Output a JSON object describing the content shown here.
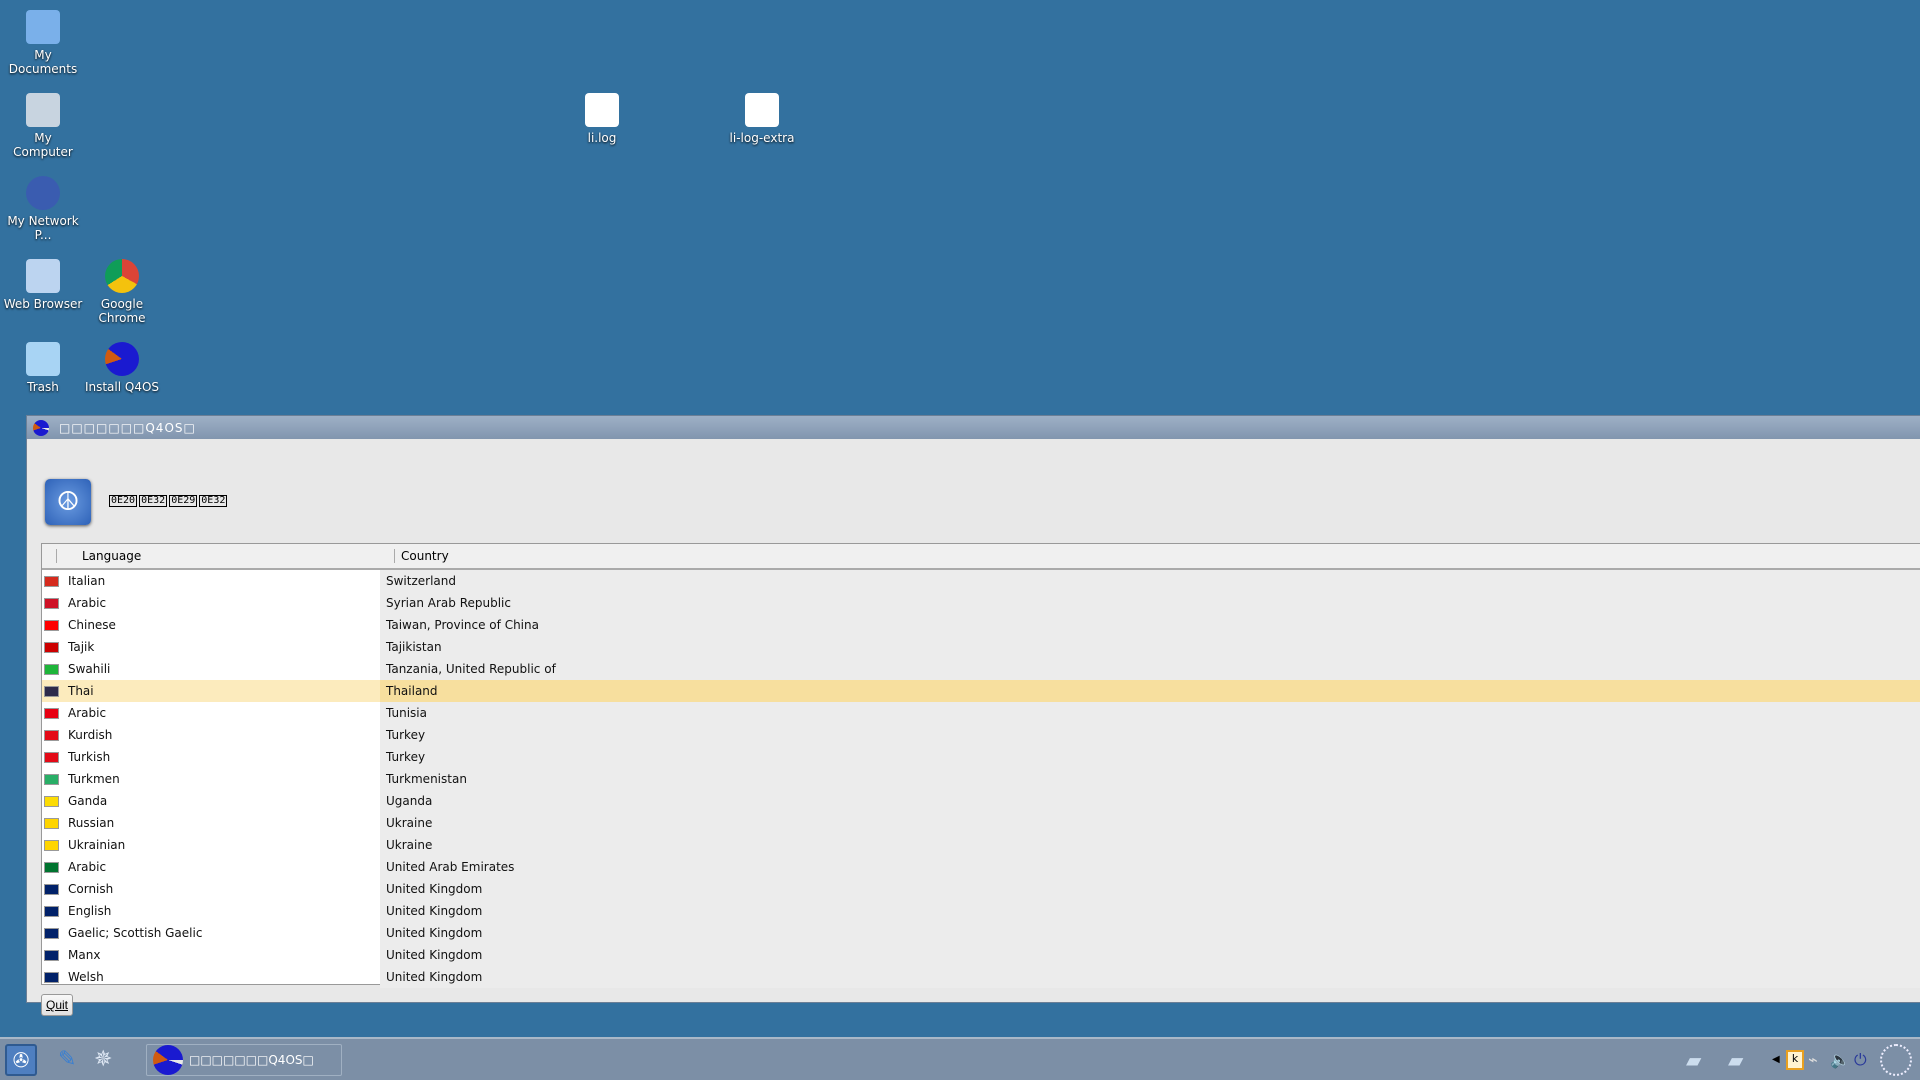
{
  "desktop": {
    "icons": [
      {
        "label": "My Documents",
        "icon": "folder-icon"
      },
      {
        "label": "My Computer",
        "icon": "computer-icon"
      },
      {
        "label": "My Network P...",
        "icon": "network-icon"
      },
      {
        "label": "Web Browser",
        "icon": "web-browser-icon"
      },
      {
        "label": "Google Chrome",
        "icon": "chrome-icon"
      },
      {
        "label": "Trash",
        "icon": "trash-icon"
      },
      {
        "label": "Install Q4OS",
        "icon": "q4os-icon"
      },
      {
        "label": "li.log",
        "icon": "chart-document-icon"
      },
      {
        "label": "li-log-extra",
        "icon": "text-document-icon"
      }
    ]
  },
  "window": {
    "title": "□□□□□□□Q4OS□",
    "header_text": [
      "0E20",
      "0E32",
      "0E29",
      "0E32"
    ],
    "columns": [
      "Language",
      "Country"
    ],
    "rows": [
      {
        "language": "Italian",
        "country": "Switzerland",
        "flag": "#d52b1e"
      },
      {
        "language": "Arabic",
        "country": "Syrian Arab Republic",
        "flag": "#ce1126"
      },
      {
        "language": "Chinese",
        "country": "Taiwan, Province of China",
        "flag": "#fe0000"
      },
      {
        "language": "Tajik",
        "country": "Tajikistan",
        "flag": "#cc0000"
      },
      {
        "language": "Swahili",
        "country": "Tanzania, United Republic of",
        "flag": "#1eb53a"
      },
      {
        "language": "Thai",
        "country": "Thailand",
        "flag": "#2d2a4a",
        "selected": true
      },
      {
        "language": "Arabic",
        "country": "Tunisia",
        "flag": "#e70013"
      },
      {
        "language": "Kurdish",
        "country": "Turkey",
        "flag": "#e30a17"
      },
      {
        "language": "Turkish",
        "country": "Turkey",
        "flag": "#e30a17"
      },
      {
        "language": "Turkmen",
        "country": "Turkmenistan",
        "flag": "#28ae66"
      },
      {
        "language": "Ganda",
        "country": "Uganda",
        "flag": "#fcdc04"
      },
      {
        "language": "Russian",
        "country": "Ukraine",
        "flag": "#ffd500"
      },
      {
        "language": "Ukrainian",
        "country": "Ukraine",
        "flag": "#ffd500"
      },
      {
        "language": "Arabic",
        "country": "United Arab Emirates",
        "flag": "#00732f"
      },
      {
        "language": "Cornish",
        "country": "United Kingdom",
        "flag": "#012169"
      },
      {
        "language": "English",
        "country": "United Kingdom",
        "flag": "#012169"
      },
      {
        "language": "Gaelic; Scottish Gaelic",
        "country": "United Kingdom",
        "flag": "#012169"
      },
      {
        "language": "Manx",
        "country": "United Kingdom",
        "flag": "#012169"
      },
      {
        "language": "Welsh",
        "country": "United Kingdom",
        "flag": "#012169"
      }
    ],
    "quit_label": "Quit"
  },
  "taskbar": {
    "task_label": "□□□□□□□Q4OS□"
  }
}
